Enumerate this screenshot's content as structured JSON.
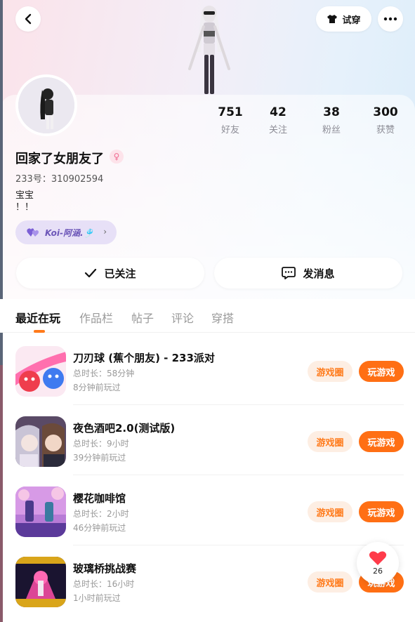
{
  "header": {
    "try_on_label": "试穿"
  },
  "stats": [
    {
      "value": "751",
      "label": "好友"
    },
    {
      "value": "42",
      "label": "关注"
    },
    {
      "value": "38",
      "label": "粉丝"
    },
    {
      "value": "300",
      "label": "获赞"
    }
  ],
  "profile": {
    "name": "回家了女朋友了",
    "gender_symbol": "♀",
    "uid": "233号：310902594",
    "bio": "宝宝\n！！",
    "cp_name": "Koi-阿涵.🎐"
  },
  "actions": {
    "follow_label": "已关注",
    "message_label": "发消息"
  },
  "tabs": [
    {
      "label": "最近在玩",
      "active": true
    },
    {
      "label": "作品栏",
      "active": false
    },
    {
      "label": "帖子",
      "active": false
    },
    {
      "label": "评论",
      "active": false
    },
    {
      "label": "穿搭",
      "active": false
    }
  ],
  "games": [
    {
      "name": "刀刃球 (蕉个朋友) - 233派对",
      "duration": "总时长：58分钟",
      "last_played": "8分钟前玩过",
      "circle_label": "游戏圈",
      "play_label": "玩游戏"
    },
    {
      "name": "夜色酒吧2.0(测试版)",
      "duration": "总时长：9小时",
      "last_played": "39分钟前玩过",
      "circle_label": "游戏圈",
      "play_label": "玩游戏"
    },
    {
      "name": "樱花咖啡馆",
      "duration": "总时长：2小时",
      "last_played": "46分钟前玩过",
      "circle_label": "游戏圈",
      "play_label": "玩游戏"
    },
    {
      "name": "玻璃桥挑战赛",
      "duration": "总时长：16小时",
      "last_played": "1小时前玩过",
      "circle_label": "游戏圈",
      "play_label": "玩游戏"
    }
  ],
  "like_widget": {
    "count": "26"
  },
  "colors": {
    "accent": "#ff6f14",
    "accent_light": "#fdeee3",
    "cp_pill": "#e7e0f7"
  }
}
